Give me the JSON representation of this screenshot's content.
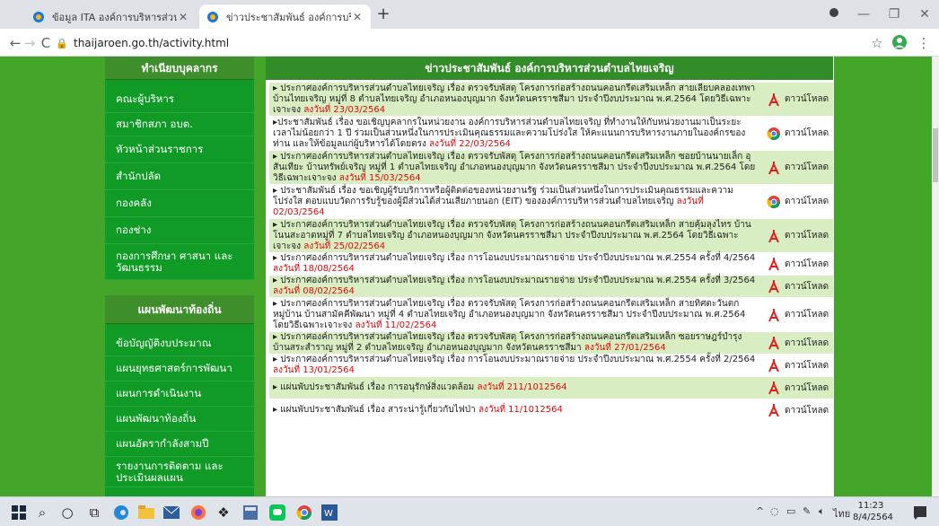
{
  "browser": {
    "tabs": [
      {
        "title": "ข้อมูล ITA องค์การบริหารส่วนตำบลไทย"
      },
      {
        "title": "ข่าวประชาสัมพันธ์ องค์การบริหารส่วนต"
      }
    ],
    "new_tab": "+",
    "url": "thaijaroen.go.th/activity.html"
  },
  "sidebar": {
    "header1": "ทำเนียบบุคลากร",
    "items1": [
      {
        "label": "คณะผู้บริหาร"
      },
      {
        "label": "สมาชิกสภา อบต."
      },
      {
        "label": "หัวหน้าส่วนราชการ"
      },
      {
        "label": "สำนักปลัด"
      },
      {
        "label": "กองคลัง"
      },
      {
        "label": "กองช่าง"
      },
      {
        "label": "กองการศึกษา ศาสนา และวัฒนธรรม"
      }
    ],
    "header2": "แผนพัฒนาท้องถิ่น",
    "items2": [
      {
        "label": "ข้อบัญญัติงบประมาณ"
      },
      {
        "label": "แผนยุทธศาสตร์การพัฒนา"
      },
      {
        "label": "แผนการดำเนินงาน"
      },
      {
        "label": "แผนพัฒนาท้องถิ่น"
      },
      {
        "label": "แผนอัตรากำลังสามปี"
      },
      {
        "label": "รายงานการติดตาม และประเมินผลแผน"
      }
    ]
  },
  "content": {
    "title": "ข่าวประชาสัมพันธ์ องค์การบริหารส่วนตำบลไทยเจริญ",
    "download_label": "ดาวน์โหลด",
    "rows": [
      {
        "text": "▸ ประกาศองค์การบริหารส่วนตำบลไทยเจริญ เรื่อง ตรวจรับพัสดุ โครงการก่อสร้างถนนคอนกรีตเสริมเหล็ก สายเลียบคลองเทพา บ้านไทยเจริญ หมู่ที่ 8 ตำบลไทยเจริญ อำเภอหนองบุญมาก จังหวัดนครราชสีมา ประจำปีงบประมาณ พ.ศ.2564 โดยวิธีเฉพาะเจาะจง",
        "date": "ลงวันที่ 23/03/2564",
        "icon": "pdf-icon"
      },
      {
        "text": "▸ประชาสัมพันธ์ เรื่อง ขอเชิญบุคลากรในหน่วยงาน องค์การบริหารส่วนตำบลไทยเจริญ ที่ทำงานให้กับหน่วยงานมาเป็นระยะเวลาไม่น้อยกว่า 1 ปี ร่วมเป็นส่วนหนึ่งในการประเมินคุณธรรมและความโปร่งใส ให้คะแนนการบริหารงานภายในองค์กรของท่าน และให้ข้อมูลแก่ผู้บริหารได้โดยตรง",
        "date": "ลงวันที่ 22/03/2564",
        "icon": "chrome-icon"
      },
      {
        "text": "▸ ประกาศองค์การบริหารส่วนตำบลไทยเจริญ เรื่อง ตรวจรับพัสดุ โครงการก่อสร้างถนนคอนกรีตเสริมเหล็ก ซอยบ้านนายเล็ก อุสันเทียะ บ้านทรัพย์เจริญ หมู่ที่ 1 ตำบลไทยเจริญ อำเภอหนองบุญมาก จังหวัดนครราชสีมา ประจำปีงบประมาณ พ.ศ.2564 โดยวิธีเฉพาะเจาะจง",
        "date": "ลงวันที่ 15/03/2564",
        "icon": "pdf-icon"
      },
      {
        "text": "▸ ประชาสัมพันธ์ เรื่อง ขอเชิญผู้รับบริการหรือผู้ติดต่อของหน่วยงานรัฐ ร่วมเป็นส่วนหนึ่งในการประเมินคุณธรรมและความโปร่งใส ตอบแบบวัดการรับรู้ของผู้มีส่วนได้ส่วนเสียภายนอก (EIT) ขององค์การบริหารส่วนตำบลไทยเจริญ",
        "date": "ลงวันที่ 02/03/2564",
        "icon": "chrome-icon"
      },
      {
        "text": "▸ ประกาศองค์การบริหารส่วนตำบลไทยเจริญ เรื่อง ตรวจรับพัสดุ โครงการก่อสร้างถนนคอนกรีตเสริมเหล็ก สายคุ้มลุงไทร บ้านโนนสะอาดหมู่ที่ 7 ตำบลไทยเจริญ อำเภอหนองบุญมาก จังหวัดนครราชสีมา ประจำปีงบประมาณ พ.ศ.2564 โดยวิธีเฉพาะเจาะจง",
        "date": "ลงวันที่ 25/02/2564",
        "icon": "pdf-icon"
      },
      {
        "text": "▸ ประกาศองค์การบริหารส่วนตำบลไทยเจริญ เรื่อง การโอนงบประมาณรายจ่าย ประจำปีงบประมาณ พ.ศ.2554 ครั้งที่ 4/2564",
        "date": "ลงวันที่ 18/08/2564",
        "icon": "pdf-icon"
      },
      {
        "text": "▸ ประกาศองค์การบริหารส่วนตำบลไทยเจริญ เรื่อง การโอนงบประมาณรายจ่าย ประจำปีงบประมาณ พ.ศ.2554 ครั้งที่ 3/2564",
        "date": "ลงวันที่ 08/02/2564",
        "icon": "pdf-icon"
      },
      {
        "text": "▸ ประกาศองค์การบริหารส่วนตำบลไทยเจริญ เรื่อง ตรวจรับพัสดุ โครงการก่อสร้างถนนคอนกรีตเสริมเหล็ก สายทิศตะวันตกหมู่บ้าน บ้านสามัคคีพัฒนา หมู่ที่ 4 ตำบลไทยเจริญ อำเภอหนองบุญมาก จังหวัดนครราชสีมา ประจำปีงบประมาณ พ.ศ.2564 โดยวิธีเฉพาะเจาะจง",
        "date": "ลงวันที่ 11/02/2564",
        "icon": "pdf-icon"
      },
      {
        "text": "▸ ประกาศองค์การบริหารส่วนตำบลไทยเจริญ เรื่อง ตรวจรับพัสดุ โครงการก่อสร้างถนนคอนกรีตเสริมเหล็ก ซอยราษฎร์บำรุง บ้านสระสำราญ หมู่ที่ 2 ตำบลไทยเจริญ อำเภอหนองบุญมาก จังหวัดนครราชสีมา",
        "date": "ลงวันที่ 27/01/2564",
        "icon": "pdf-icon"
      },
      {
        "text": "▸ ประกาศองค์การบริหารส่วนตำบลไทยเจริญ เรื่อง การโอนงบประมาณรายจ่าย ประจำปีงบประมาณ พ.ศ.2554 ครั้งที่ 2/2564",
        "date": "ลงวันที่ 13/01/2564",
        "icon": "pdf-icon"
      },
      {
        "text": "▸ แผ่นพับประชาสัมพันธ์ เรื่อง การอนุรักษ์สิ่งแวดล้อม",
        "date": "ลงวันที่ 211/1012564",
        "icon": "pdf-icon"
      },
      {
        "text": "▸ แผ่นพับประชาสัมพันธ์ เรื่อง สาระน่ารู้เกี่ยวกับไฟป่า",
        "date": "ลงวันที่ 11/1012564",
        "icon": "pdf-icon"
      }
    ]
  },
  "taskbar": {
    "lang": "ไทย",
    "time": "11:23",
    "date": "8/4/2564"
  }
}
